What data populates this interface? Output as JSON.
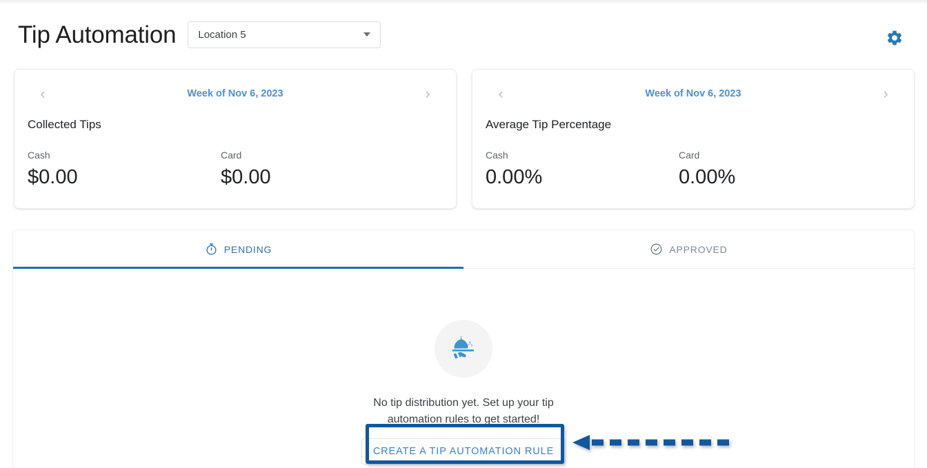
{
  "header": {
    "title": "Tip Automation",
    "location_select": {
      "value": "Location 5",
      "icon": "chevron-down-icon"
    },
    "settings_icon": "gear-icon",
    "accent_color": "#2a79b4"
  },
  "cards": [
    {
      "week_label": "Week of Nov 6, 2023",
      "prev_icon": "chevron-left-icon",
      "next_icon": "chevron-right-icon",
      "title": "Collected Tips",
      "metrics": [
        {
          "label": "Cash",
          "value": "$0.00"
        },
        {
          "label": "Card",
          "value": "$0.00"
        }
      ]
    },
    {
      "week_label": "Week of Nov 6, 2023",
      "prev_icon": "chevron-left-icon",
      "next_icon": "chevron-right-icon",
      "title": "Average Tip Percentage",
      "metrics": [
        {
          "label": "Cash",
          "value": "0.00%"
        },
        {
          "label": "Card",
          "value": "0.00%"
        }
      ]
    }
  ],
  "tabs": [
    {
      "label": "PENDING",
      "icon": "stopwatch-icon",
      "active": true
    },
    {
      "label": "APPROVED",
      "icon": "check-circle-icon",
      "active": false
    }
  ],
  "empty_state": {
    "icon": "room-service-tray-icon",
    "message_line1": "No tip distribution yet. Set up your tip",
    "message_line2": "automation rules to get started!",
    "cta_label": "CREATE A TIP AUTOMATION RULE"
  },
  "annotation": {
    "highlight_color": "#12569f",
    "arrow_icon": "dashed-arrow-left-icon"
  },
  "colors": {
    "tab_active": "#2f72ad",
    "tab_inactive": "#7b8a97",
    "link_blue": "#4a90d9",
    "cta_blue": "#3b82c4",
    "icon_blue": "#3b95cf"
  }
}
